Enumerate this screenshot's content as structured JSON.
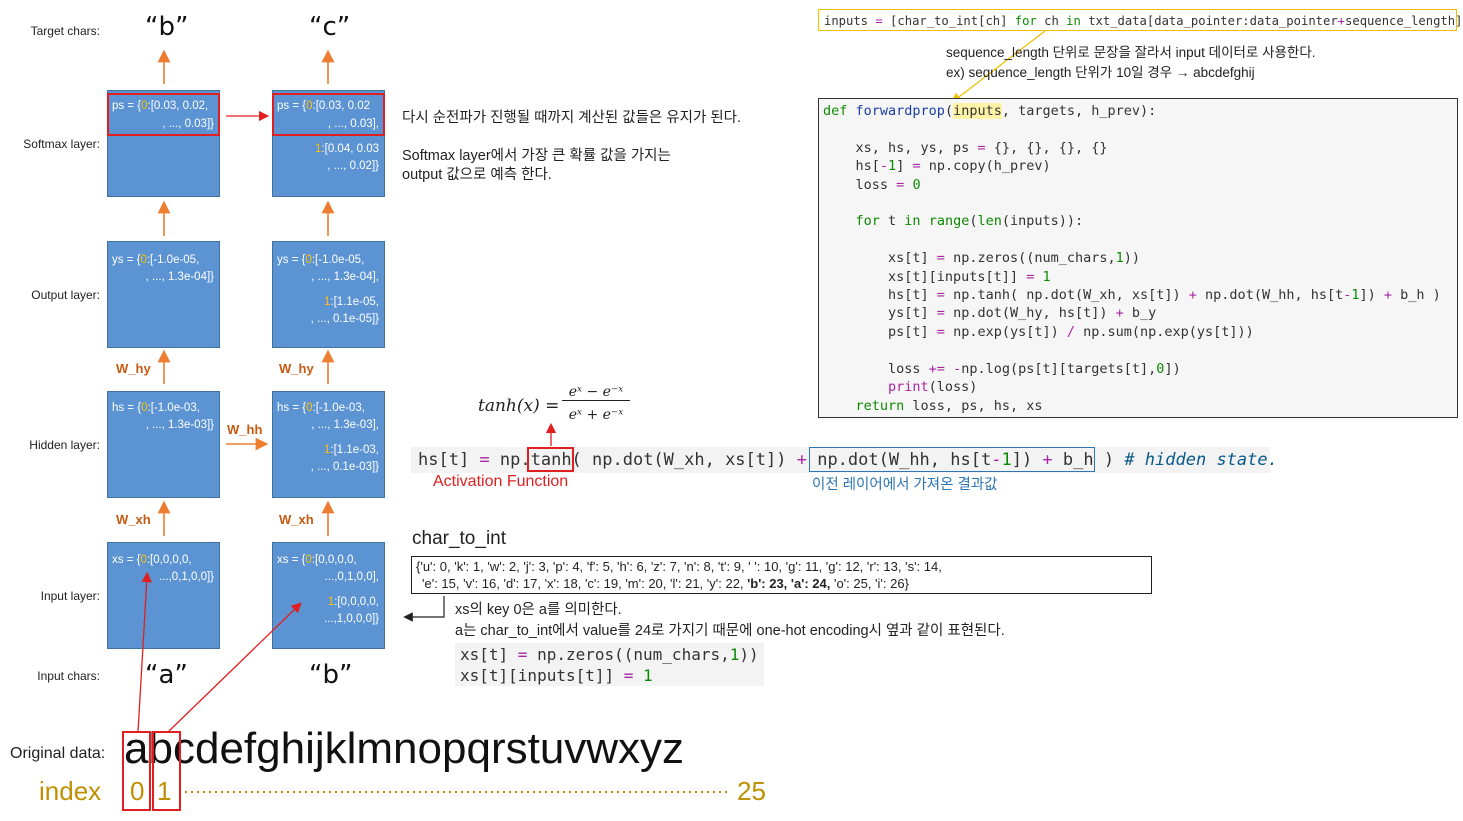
{
  "labels": {
    "target_chars": "Target chars:",
    "softmax_layer": "Softmax layer:",
    "output_layer": "Output layer:",
    "hidden_layer": "Hidden layer:",
    "input_layer": "Input layer:",
    "input_chars": "Input chars:",
    "original_data": "Original data:",
    "index": "index"
  },
  "target_chars": [
    "“b”",
    "“c”"
  ],
  "input_chars": [
    "“a”",
    "“b”"
  ],
  "weights": {
    "w_hy": "W_hy",
    "w_hh": "W_hh",
    "w_xh": "W_xh"
  },
  "boxes": {
    "ps0": {
      "l1a": "ps = {",
      "l1k": "0",
      "l1b": ":[0.03, 0.02,",
      "l2": ", ..., 0.03]}"
    },
    "ps1": {
      "l1a": "ps = {",
      "l1k": "0",
      "l1b": ":[0.03, 0.02",
      "l2": ", ..., 0.03],",
      "l3k": "1",
      "l3b": ":[0.04, 0.03",
      "l4": ", ..., 0.02]}"
    },
    "ys0": {
      "l1a": "ys = {",
      "l1k": "0",
      "l1b": ":[-1.0e-05,",
      "l2": ", ..., 1.3e-04]}"
    },
    "ys1": {
      "l1a": "ys = {",
      "l1k": "0",
      "l1b": ":[-1.0e-05,",
      "l2": ", ..., 1.3e-04],",
      "l3k": "1",
      "l3b": ":[1.1e-05,",
      "l4": ", ..., 0.1e-05]}"
    },
    "hs0": {
      "l1a": "hs = {",
      "l1k": "0",
      "l1b": ":[-1.0e-03,",
      "l2": ", ..., 1.3e-03]}"
    },
    "hs1": {
      "l1a": "hs = {",
      "l1k": "0",
      "l1b": ":[-1.0e-03,",
      "l2": ", ..., 1.3e-03],",
      "l3k": "1",
      "l3b": ":[1.1e-03,",
      "l4": ", ..., 0.1e-03]}"
    },
    "xs0": {
      "l1a": "xs = {",
      "l1k": "0",
      "l1b": ":[0,0,0,0,",
      "l2": "...,0,1,0,0]}"
    },
    "xs1": {
      "l1a": "xs = {",
      "l1k": "0",
      "l1b": ":[0,0,0,0,",
      "l2": "...,0,1,0,0],",
      "l3k": "1",
      "l3b": ":[0,0,0,0,",
      "l4": "...,1,0,0,0]}"
    }
  },
  "notes": {
    "keep_values": "다시 순전파가 진행될 때까지 계산된 값들은 유지가 된다.",
    "softmax_1": "Softmax layer에서 가장 큰 확률 값을 가지는",
    "softmax_2": "output 값으로 예측 한다.",
    "seq_1": "sequence_length 단위로 문장을 잘라서 input 데이터로 사용한다.",
    "seq_2": "ex) sequence_length 단위가 10일 경우 → abcdefghij",
    "activation": "Activation Function",
    "prev_layer": "이전 레이어에서 가져온 결과값",
    "char_to_int_title": "char_to_int",
    "xs_key_1": "xs의 key 0은 a를 의미한다.",
    "xs_key_2": "a는 char_to_int에서 value를 24로 가지기 때문에 one-hot encoding시 옆과 같이 표현된다."
  },
  "formula": {
    "lhs": "tanh(x) =",
    "num": "eˣ − e⁻ˣ",
    "den": "eˣ + e⁻ˣ"
  },
  "dict_text": {
    "line1": "{'u': 0, 'k': 1, 'w': 2, 'j': 3, 'p': 4, 'f': 5, 'h': 6, 'z': 7, 'n': 8, 't': 9, ' ': 10, 'g': 11, 'g': 12, 'r': 13, 's': 14,",
    "line2a": "'e': 15, 'v': 16, 'd': 17, 'x': 18, 'c': 19, 'm': 20, 'l': 21, 'y': 22, ",
    "line2b": "'b': 23, 'a': 24,",
    "line2c": " 'o': 25, 'i': 26}"
  },
  "original_data": {
    "first": "a",
    "second": "b",
    "rest": "cdefghijklmnopqrstuvwxyz"
  },
  "index_values": {
    "i0": "0",
    "i1": "1",
    "last": "25"
  }
}
